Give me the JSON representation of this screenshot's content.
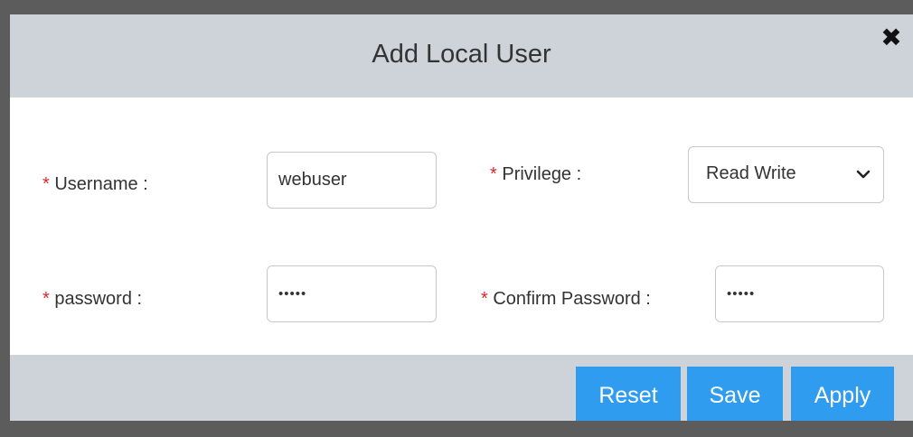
{
  "dialog": {
    "title": "Add Local User",
    "close_icon": "close-icon"
  },
  "form": {
    "required_mark": "*",
    "username": {
      "label": "Username :",
      "value": "webuser"
    },
    "privilege": {
      "label": "Privilege :",
      "selected": "Read Write",
      "icon": "chevron-down-icon"
    },
    "password": {
      "label": "password :",
      "value": "•••••"
    },
    "confirm_password": {
      "label": "Confirm Password :",
      "value": "•••••"
    }
  },
  "footer": {
    "reset_label": "Reset",
    "save_label": "Save",
    "apply_label": "Apply"
  },
  "colors": {
    "header_bg": "#cdd3d9",
    "button_bg": "#2f9cf0",
    "required_mark": "#e0242b"
  }
}
